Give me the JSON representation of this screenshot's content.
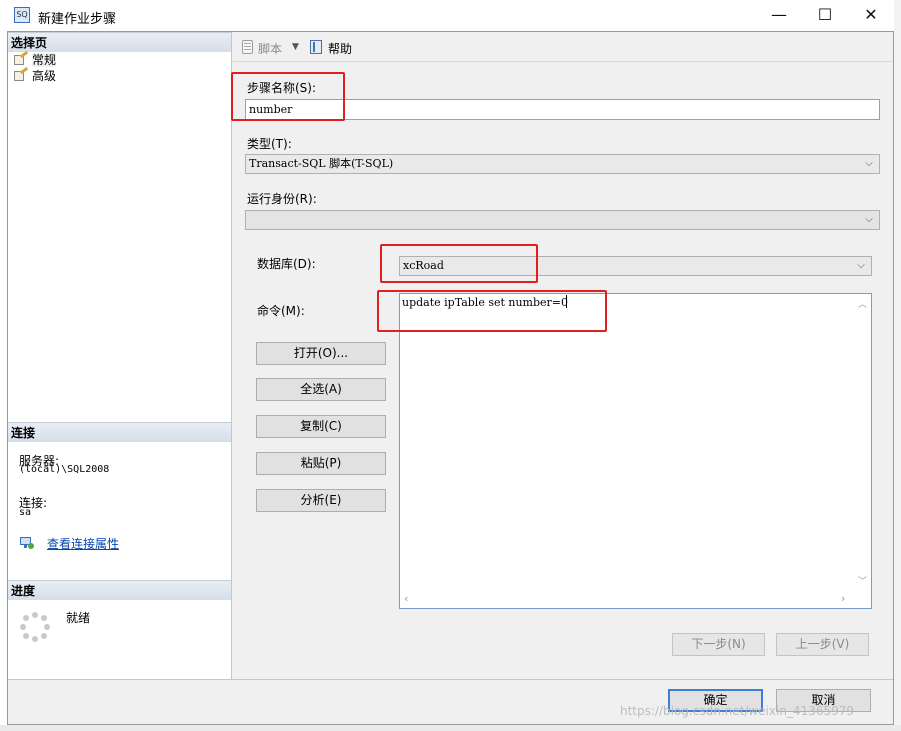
{
  "window": {
    "title": "新建作业步骤",
    "icon": "sql-agent-icon",
    "minimize": "—",
    "maximize": "☐",
    "close": "✕"
  },
  "left_panel": {
    "select_page_header": "选择页",
    "pages": [
      {
        "label": "常规",
        "icon": "property-page-icon",
        "selected": true
      },
      {
        "label": "高级",
        "icon": "property-page-icon",
        "selected": false
      }
    ],
    "connection_header": "连接",
    "server_label": "服务器:",
    "server_value": "(local)\\SQL2008",
    "connection_label": "连接:",
    "connection_value": "sa",
    "view_connection_link": "查看连接属性",
    "progress_header": "进度",
    "progress_status": "就绪"
  },
  "toolbar": {
    "script_label": "脚本",
    "help_label": "帮助"
  },
  "form": {
    "step_name_label": "步骤名称(S):",
    "step_name_value": "number",
    "type_label": "类型(T):",
    "type_value": "Transact-SQL 脚本(T-SQL)",
    "run_as_label": "运行身份(R):",
    "run_as_value": "",
    "database_label": "数据库(D):",
    "database_value": "xcRoad",
    "command_label": "命令(M):",
    "command_value": "update ipTable set number=0"
  },
  "command_buttons": {
    "open": "打开(O)...",
    "select_all": "全选(A)",
    "copy": "复制(C)",
    "paste": "粘贴(P)",
    "parse": "分析(E)"
  },
  "nav_buttons": {
    "next": "下一步(N)",
    "previous": "上一步(V)"
  },
  "dialog_buttons": {
    "ok": "确定",
    "cancel": "取消"
  },
  "watermark": "https://blog.csdn.net/weixin_41365979",
  "colors": {
    "highlight_box": "#e02020",
    "link": "#0645ad",
    "header_gradient": "#d6dee9"
  }
}
